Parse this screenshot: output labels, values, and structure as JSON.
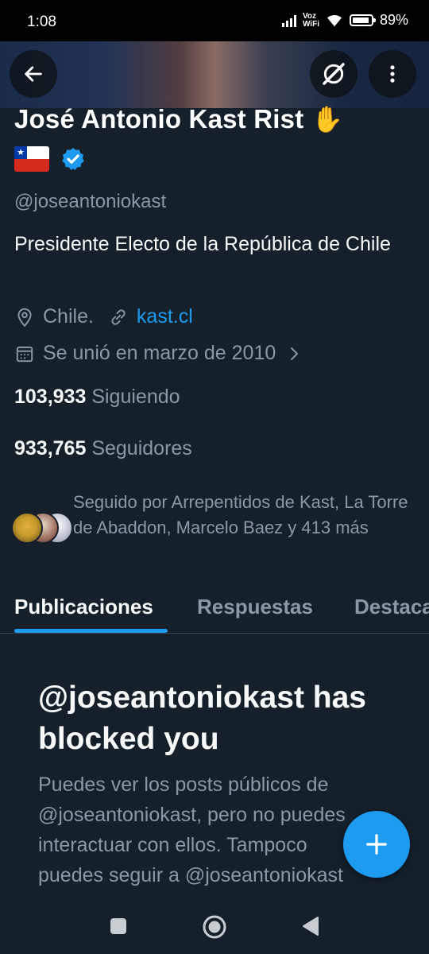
{
  "status_bar": {
    "time": "1:08",
    "network_label": "Voz\nWiFi",
    "network_line1": "Voz",
    "network_line2": "WiFi",
    "battery_percent": "89%",
    "battery_level": 0.89
  },
  "header": {
    "back_icon": "arrow-left-icon",
    "grok_icon": "grok-icon",
    "more_icon": "more-vertical-icon"
  },
  "profile": {
    "name": "José Antonio Kast Rist",
    "name_emoji": "✋",
    "flag_icon": "chile-flag-icon",
    "verified_color": "#1d9bf0",
    "handle": "@joseantoniokast",
    "bio": "Presidente Electo de la República de Chile",
    "location": "Chile.",
    "website": "kast.cl",
    "joined": "Se unió en marzo de 2010",
    "following_count": "103,933",
    "following_label": "Siguiendo",
    "followers_count": "933,765",
    "followers_label": "Seguidores",
    "followed_by": "Seguido por Arrepentidos de Kast, La Torre de Abaddon, Marcelo Baez y 413 más"
  },
  "tabs": [
    {
      "label": "Publicaciones",
      "active": true
    },
    {
      "label": "Respuestas",
      "active": false
    },
    {
      "label": "Destacados",
      "active": false
    }
  ],
  "blocked": {
    "title": "@joseantoniokast has blocked you",
    "description": "Puedes ver los posts públicos de @joseantoniokast, pero no puedes interactuar con ellos. Tampoco puedes seguir a @joseantoniokast ni ver quién lo sigue."
  },
  "fab": {
    "icon": "plus-icon"
  },
  "nav": {
    "icons": [
      "recents-square-icon",
      "home-circle-icon",
      "back-triangle-icon"
    ]
  },
  "colors": {
    "background": "#15202b",
    "accent": "#1d9bf0",
    "secondary_text": "#8b98a5"
  }
}
